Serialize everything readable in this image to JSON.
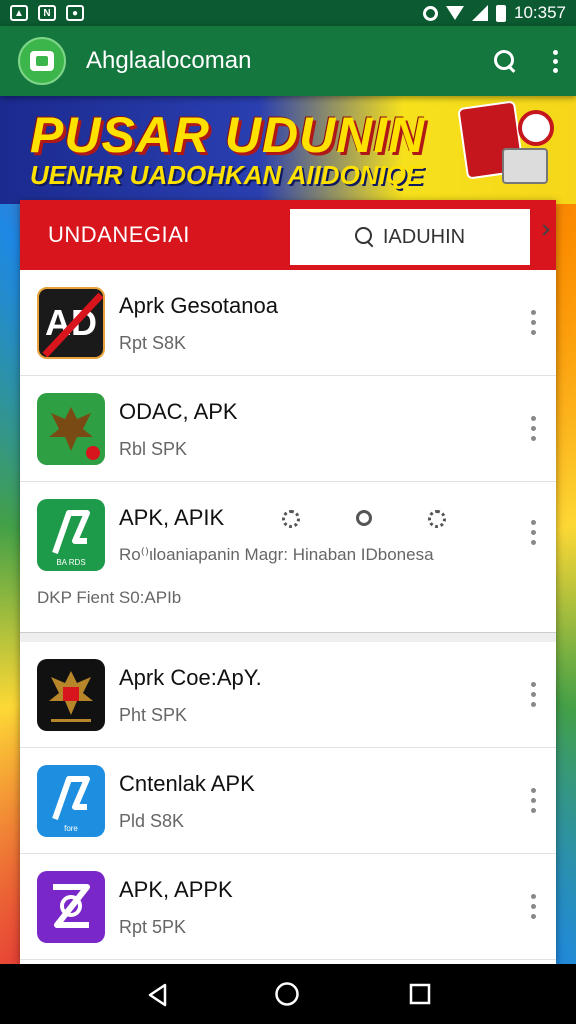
{
  "status_bar": {
    "time": "10:357",
    "left_icons": [
      "image-icon",
      "nfc-icon",
      "message-icon"
    ],
    "right_icons": [
      "hotspot-icon",
      "wifi-icon",
      "signal-icon",
      "battery-icon"
    ]
  },
  "app_bar": {
    "title": "Ahglaalocoman",
    "actions": [
      "search-icon",
      "more-vert-icon"
    ]
  },
  "banner": {
    "headline": "PUSAR UDUNIN",
    "subheadline": "UENHR UADOHKAN AIIDONIQE"
  },
  "card_header": {
    "label": "UNDANEGIAI",
    "search_text": "IADUHIN"
  },
  "apps": [
    {
      "name": "Aprk Gesotanoa",
      "meta": "Rpt S8K",
      "icon_color": "#1a1a1a",
      "icon_name": "adb-icon"
    },
    {
      "name": "ODAC, APK",
      "meta": "Rbl SPK",
      "icon_color": "#2ea043",
      "icon_name": "garuda-icon"
    },
    {
      "name": "APK, APIK",
      "meta": "Ro⁽⁾ιloaniapanin Magr: Hinaban IDbonesa",
      "footnote": "DKP Fient S0:APIb",
      "icon_color": "#1d9a4a",
      "icon_name": "apk-a-icon",
      "icon_caption": "BA RDS"
    },
    {
      "name": "Aprk Coe:ApY.",
      "meta": "Pht SPK",
      "icon_color": "#111111",
      "icon_name": "garuda-icon"
    },
    {
      "name": "Cntenlak APK",
      "meta": "Pld S8K",
      "icon_color": "#1e8fe0",
      "icon_name": "apk-a-icon",
      "icon_caption": "fore"
    },
    {
      "name": "APK, APPK",
      "meta": "Rpt 5PK",
      "icon_color": "#7a27c9",
      "icon_name": "apk-z-icon"
    }
  ],
  "colors": {
    "status_bar": "#0b5a31",
    "app_bar": "#14773e",
    "card_header": "#d8141c"
  }
}
